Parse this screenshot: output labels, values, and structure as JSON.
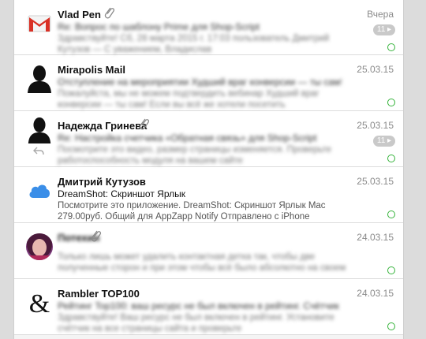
{
  "messages": [
    {
      "sender": "Vlad Pen",
      "date": "Вчера",
      "subject": "Re: Вопрос по шаблону Prime для Shop-Script",
      "preview": "Здравствуйте! Сб, 28 марта 2015 г. 17:03 пользователь Дмитрий Кутузов — С уважением, Владислав",
      "count": "11",
      "avatar_icon": "gmail-icon",
      "attachment": true
    },
    {
      "sender": "Mirapolis Mail",
      "date": "25.03.15",
      "subject": "Отступление на мероприятии Худший враг конверсии — ты сам!",
      "preview": "Пожалуйста, мы не можем подтвердить вебинар Худший враг конверсии — ты сам! Если вы всё же хотели посетить",
      "avatar_icon": "person-silhouette-icon",
      "attachment": false
    },
    {
      "sender": "Надежда Гринева",
      "date": "25.03.15",
      "subject": "Re: Настройка счетчика «Обратная связь» для Shop-Script",
      "preview": "Посмотрите это видео, размер страницы изменяется. Проверьте работоспособность модуля на вашем сайте",
      "count": "11",
      "avatar_icon": "person-silhouette-icon",
      "attachment": true,
      "replied": true
    },
    {
      "sender": "Дмитрий Кутузов",
      "date": "25.03.15",
      "subject": "DreamShot: Скриншот Ярлык",
      "preview": "Посмотрите это приложение. DreamShot: Скриншот Ярлык Mac 279.00руб. Общий для AppZapp Notify Отправлено с iPhone",
      "avatar_icon": "cloud-icon",
      "attachment": false
    },
    {
      "sender": "Потехин",
      "date": "24.03.15",
      "subject": "",
      "preview": "Только лишь может удалить контактная детка так, чтобы две полученные сторон и при этом чтобы всё было абсолютно на своем месте",
      "avatar_icon": "photo-avatar-icon",
      "attachment": true
    },
    {
      "sender": "Rambler TOP100",
      "date": "24.03.15",
      "subject": "Рейтинг Top100: ваш ресурс не был включен в рейтинг. Счётчик",
      "preview": "Здравствуйте! Ваш ресурс не был включен в рейтинг. Установите счётчик на все страницы сайта и проверьте",
      "avatar_icon": "ampersand-icon",
      "attachment": false
    }
  ],
  "colors": {
    "unread_dot": "#35b33a",
    "gmail_red": "#d93025",
    "cloud_blue": "#3a8ee8"
  }
}
